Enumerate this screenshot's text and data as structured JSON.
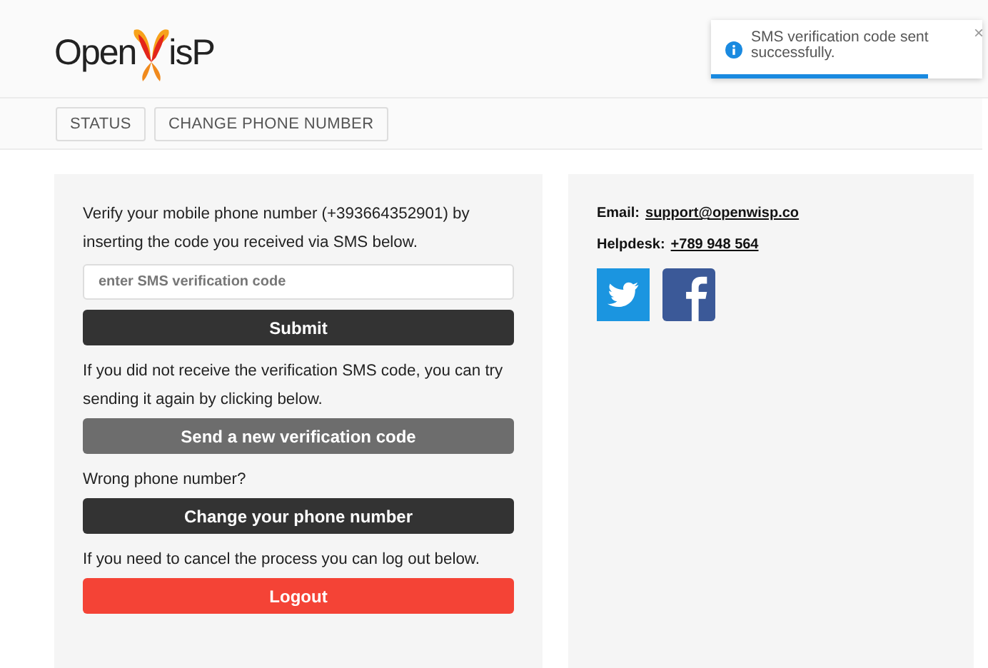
{
  "header": {
    "logo_before": "Open",
    "logo_after": "isP"
  },
  "nav": [
    {
      "label": "STATUS"
    },
    {
      "label": "CHANGE PHONE NUMBER"
    }
  ],
  "toast": {
    "message": "SMS verification code sent successfully.",
    "close": "×",
    "level": 0.8
  },
  "main": [
    {
      "kind": "text",
      "text": "Verify your mobile phone number (+393664352901) by inserting the code you received via SMS below."
    },
    {
      "kind": "field",
      "placeholder": "enter SMS verification code"
    },
    {
      "kind": "primary",
      "label": "Submit"
    },
    {
      "kind": "text",
      "text": "If you did not receive the verification SMS code, you can try sending it again by clicking below."
    },
    {
      "kind": "secondary",
      "label": "Send a new verification code"
    },
    {
      "kind": "text",
      "text": "Wrong phone number?"
    },
    {
      "kind": "primary",
      "label": "Change your phone number"
    },
    {
      "kind": "text",
      "text": "If you need to cancel the process you can log out below."
    },
    {
      "kind": "danger",
      "label": "Logout"
    }
  ],
  "contact": [
    {
      "label": "Email:",
      "link": "support@openwisp.co"
    },
    {
      "label": "Helpdesk:",
      "link": "+789 948 564"
    }
  ]
}
